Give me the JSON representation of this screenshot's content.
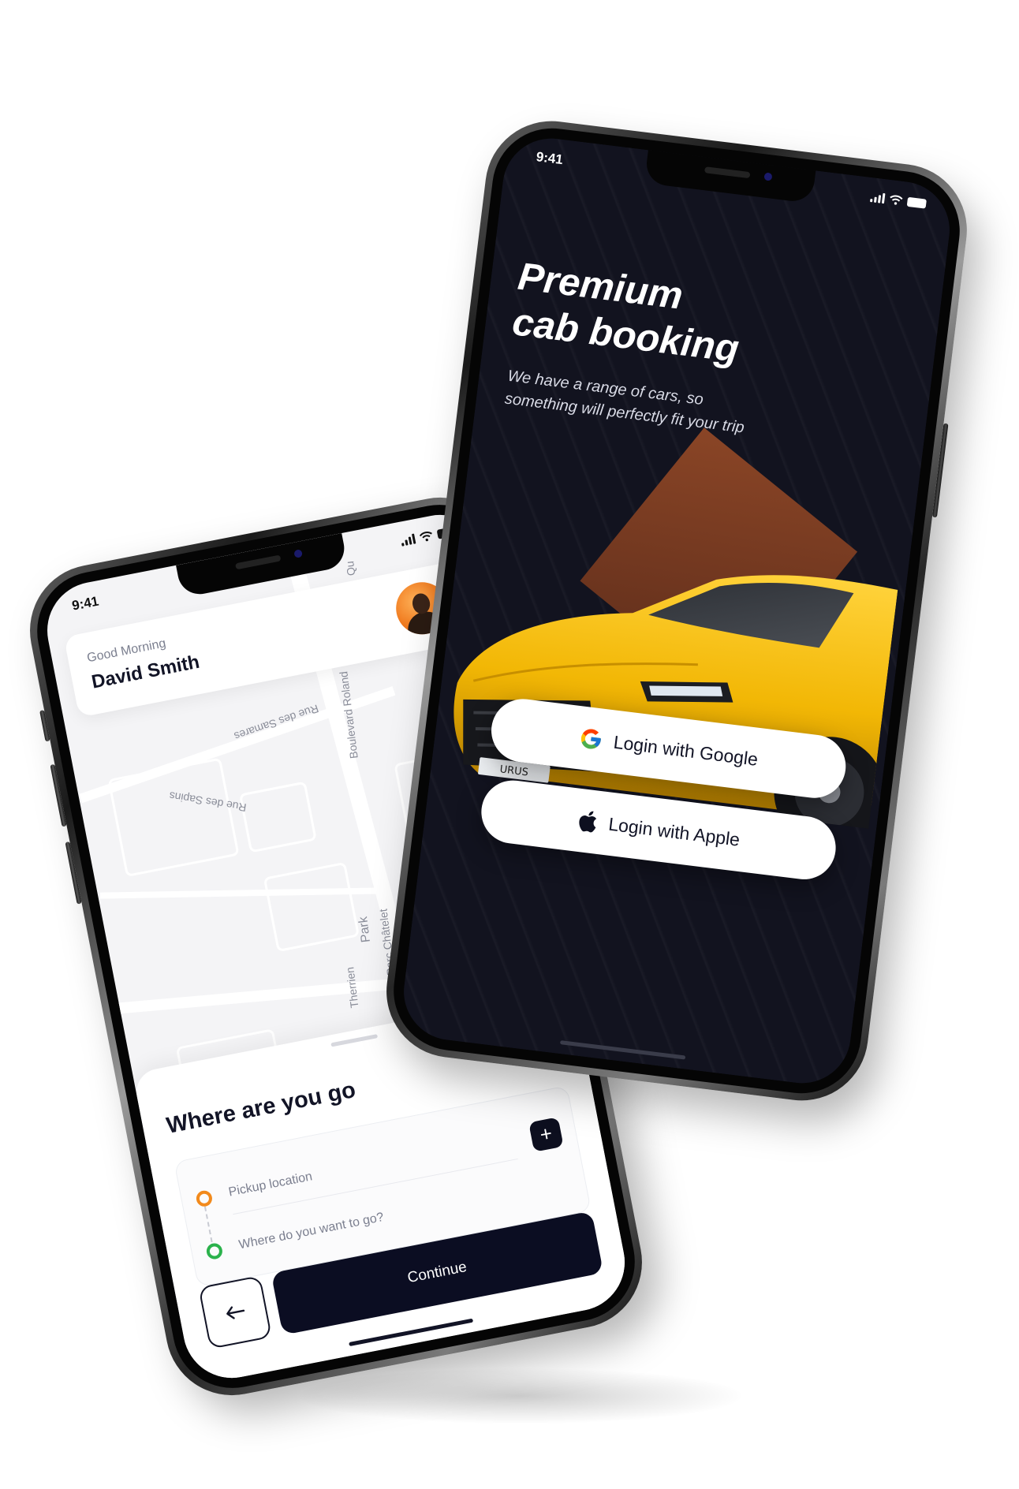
{
  "map_screen": {
    "status_time": "9:41",
    "greeting": "Good Morning",
    "user_name": "David Smith",
    "map_labels": {
      "street_1": "Rue des Samares",
      "street_2": "Rue des Sapins",
      "street_3": "Boulevard Roland",
      "street_4": "Therrien",
      "street_5": "Park",
      "street_6": "Parc Châtelet",
      "street_7": "Qu"
    },
    "sheet_title": "Where are you go",
    "pickup_placeholder": "Pickup location",
    "destination_placeholder": "Where do you want to go?",
    "add_icon": "plus-icon",
    "back_icon": "arrow-left-icon",
    "continue_label": "Continue",
    "colors": {
      "pickup_dot": "#f28a1c",
      "destination_dot": "#2bb24c",
      "primary_button": "#0b0d22"
    }
  },
  "login_screen": {
    "status_time": "9:41",
    "title": "Premium cab booking",
    "subtitle": "We have a range of cars, so something will perfectly fit your trip",
    "google_button_label": "Login with Google",
    "apple_button_label": "Login with Apple",
    "google_icon": "google-icon",
    "apple_icon": "apple-icon",
    "colors": {
      "background": "#12131f",
      "accent_shape": "#7a3c22",
      "car": "#f2b705"
    }
  }
}
